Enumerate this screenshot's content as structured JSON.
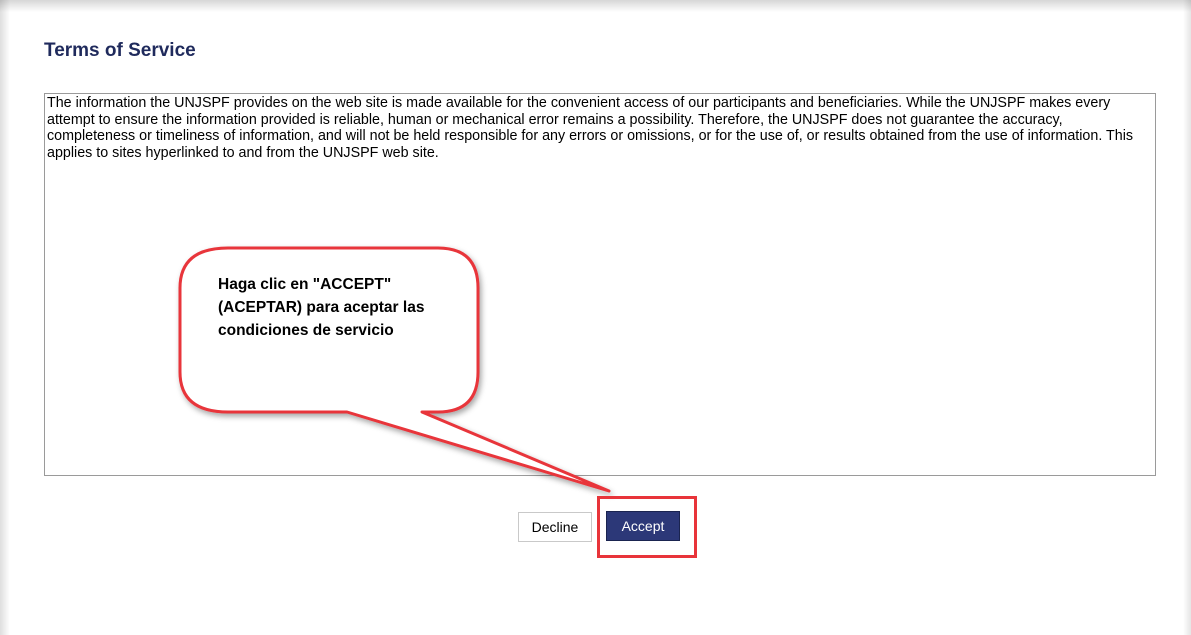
{
  "page": {
    "title": "Terms of Service"
  },
  "terms": {
    "text": "The information the UNJSPF provides on the web site is made available for the convenient access of our participants and beneficiaries. While the UNJSPF makes every attempt to ensure the information provided is reliable, human or mechanical error remains a possibility. Therefore, the UNJSPF does not guarantee the accuracy, completeness or timeliness of information, and will not be held responsible for any errors or omissions, or for the use of, or results obtained from the use of information. This applies to sites hyperlinked to and from the UNJSPF web site."
  },
  "buttons": {
    "decline_label": "Decline",
    "accept_label": "Accept"
  },
  "callout": {
    "text": "Haga clic en \"ACCEPT\" (ACEPTAR) para aceptar las condiciones de servicio"
  },
  "colors": {
    "title": "#1f2a5c",
    "accept_bg": "#2c3878",
    "annotation_red": "#e8343a"
  }
}
